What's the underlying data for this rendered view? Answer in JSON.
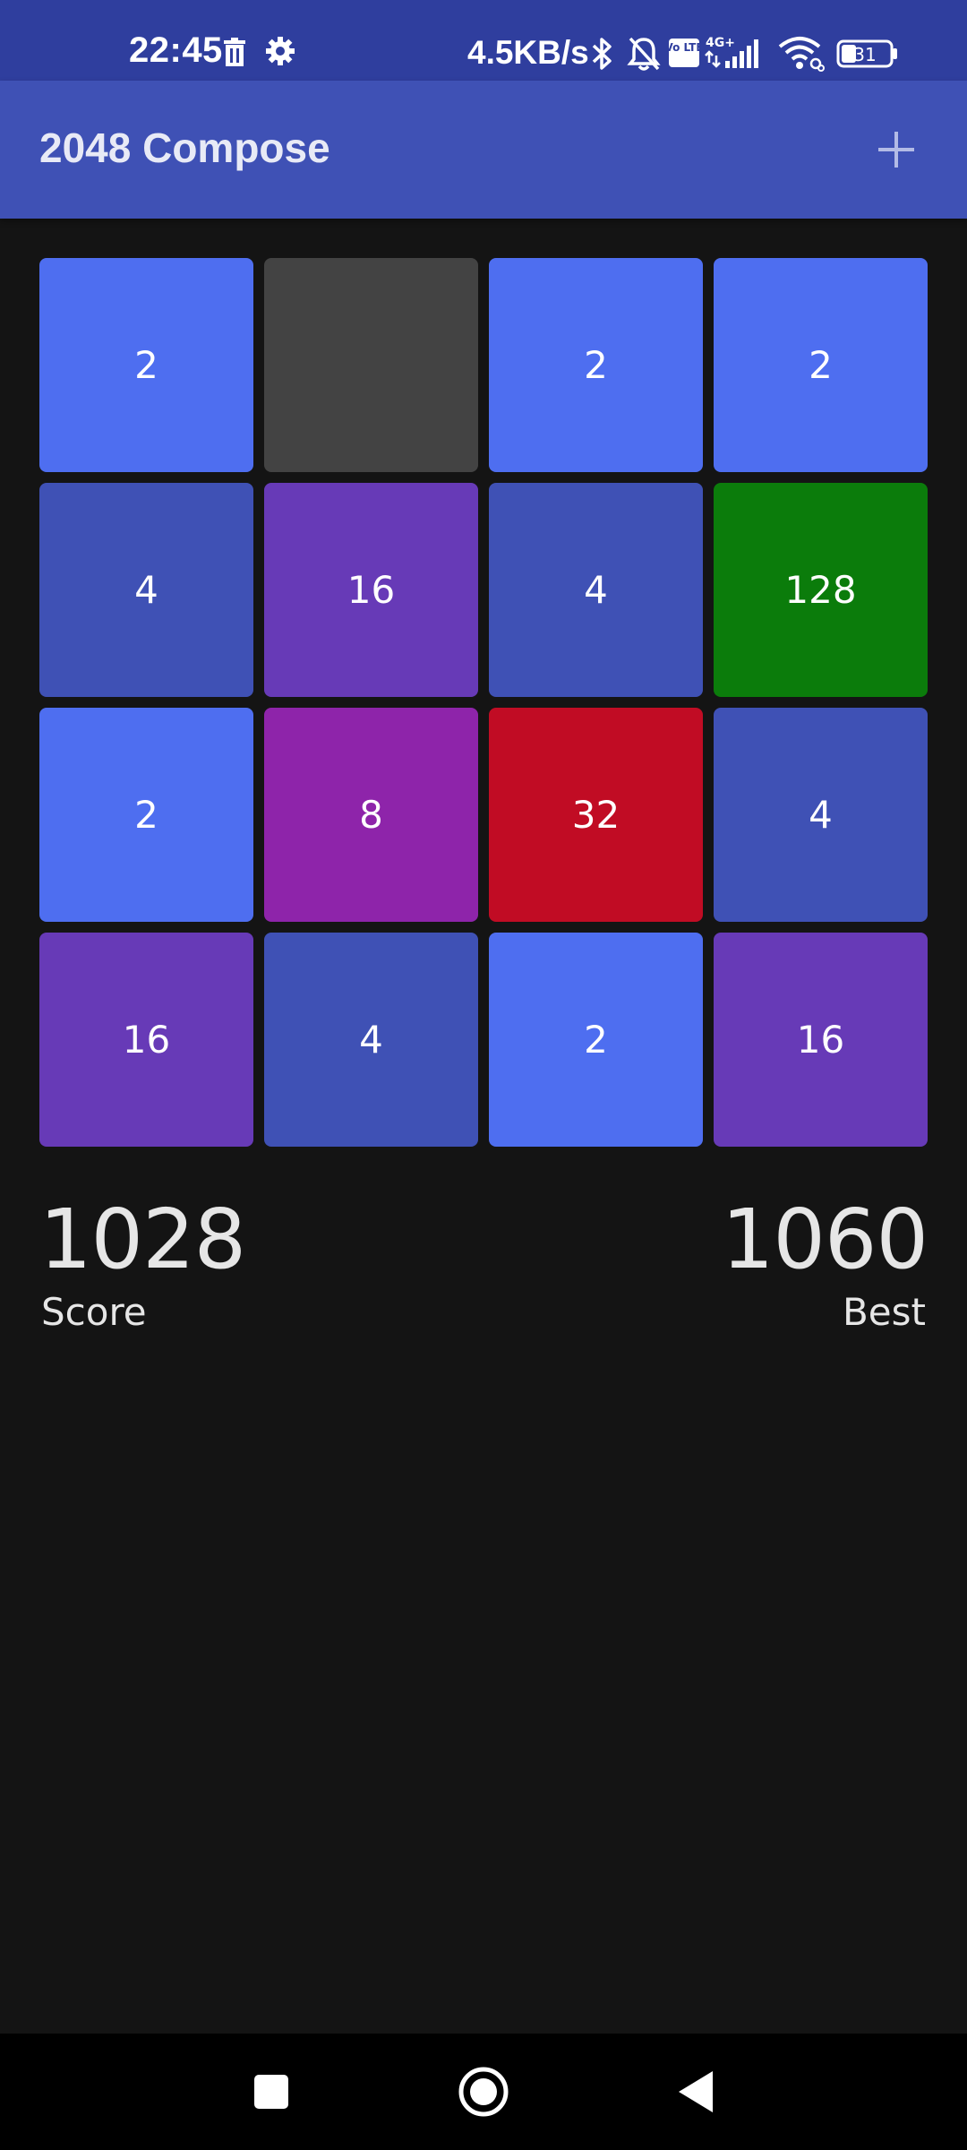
{
  "status_bar": {
    "time": "22:45",
    "network_speed": "4.5KB/s",
    "network_badge": "4G+",
    "volte_badge": "Vo LTE",
    "battery": "31",
    "icons": [
      "trash-icon",
      "gear-icon",
      "bluetooth-icon",
      "bell-muted-icon",
      "volte-icon",
      "signal-icon",
      "wifi-icon",
      "battery-icon"
    ]
  },
  "app_bar": {
    "title": "2048 Compose",
    "action_icon": "plus-icon"
  },
  "board": {
    "tiles": [
      {
        "value": "2",
        "color": "#4e6ef0"
      },
      {
        "value": "",
        "color": "#434343"
      },
      {
        "value": "2",
        "color": "#4e6ef0"
      },
      {
        "value": "2",
        "color": "#4e6ef0"
      },
      {
        "value": "4",
        "color": "#3f51b5"
      },
      {
        "value": "16",
        "color": "#673ab7"
      },
      {
        "value": "4",
        "color": "#3f51b5"
      },
      {
        "value": "128",
        "color": "#0b7c0b"
      },
      {
        "value": "2",
        "color": "#4e6ef0"
      },
      {
        "value": "8",
        "color": "#8e24aa"
      },
      {
        "value": "32",
        "color": "#c10c24"
      },
      {
        "value": "4",
        "color": "#3f51b5"
      },
      {
        "value": "16",
        "color": "#673ab7"
      },
      {
        "value": "4",
        "color": "#3f51b5"
      },
      {
        "value": "2",
        "color": "#4e6ef0"
      },
      {
        "value": "16",
        "color": "#673ab7"
      }
    ]
  },
  "scores": {
    "score_value": "1028",
    "score_label": "Score",
    "best_value": "1060",
    "best_label": "Best"
  },
  "nav_bar": {
    "icons": [
      "recents-icon",
      "home-icon",
      "back-icon"
    ]
  }
}
